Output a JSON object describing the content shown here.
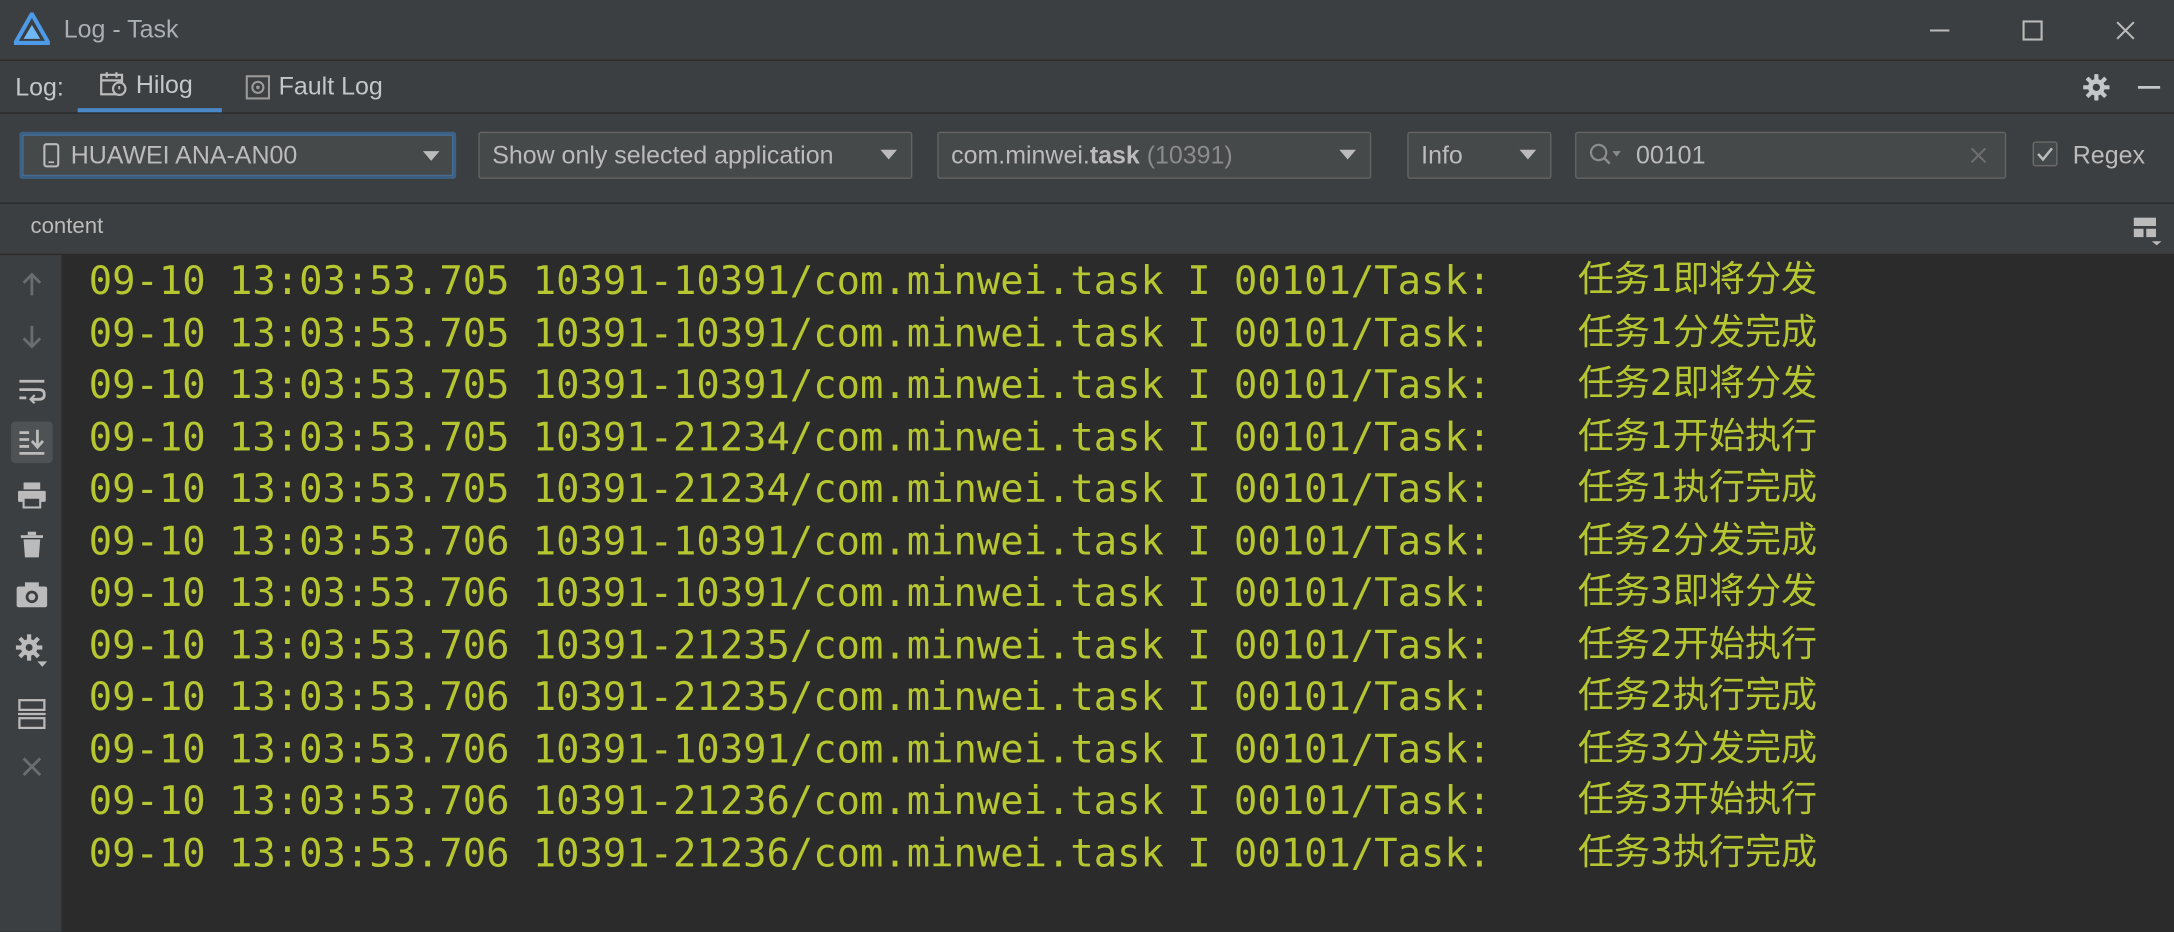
{
  "window": {
    "title": "Log - Task"
  },
  "tabs": {
    "label": "Log:",
    "items": [
      {
        "label": "Hilog"
      },
      {
        "label": "Fault Log"
      }
    ]
  },
  "filters": {
    "device": "HUAWEI ANA-AN00",
    "app_filter": "Show only selected application",
    "process_prefix": "com.minwei.",
    "process_bold": "task",
    "process_pid": "(10391)",
    "level": "Info",
    "search_value": "00101",
    "regex_label": "Regex",
    "regex_checked": true
  },
  "content_header": "content",
  "log": {
    "color": "#b6c631",
    "lines": [
      {
        "prefix": "09-10 13:03:53.705 10391-10391/com.minwei.task I 00101/Task:",
        "message": "任务1即将分发"
      },
      {
        "prefix": "09-10 13:03:53.705 10391-10391/com.minwei.task I 00101/Task:",
        "message": "任务1分发完成"
      },
      {
        "prefix": "09-10 13:03:53.705 10391-10391/com.minwei.task I 00101/Task:",
        "message": "任务2即将分发"
      },
      {
        "prefix": "09-10 13:03:53.705 10391-21234/com.minwei.task I 00101/Task:",
        "message": "任务1开始执行"
      },
      {
        "prefix": "09-10 13:03:53.705 10391-21234/com.minwei.task I 00101/Task:",
        "message": "任务1执行完成"
      },
      {
        "prefix": "09-10 13:03:53.706 10391-10391/com.minwei.task I 00101/Task:",
        "message": "任务2分发完成"
      },
      {
        "prefix": "09-10 13:03:53.706 10391-10391/com.minwei.task I 00101/Task:",
        "message": "任务3即将分发"
      },
      {
        "prefix": "09-10 13:03:53.706 10391-21235/com.minwei.task I 00101/Task:",
        "message": "任务2开始执行"
      },
      {
        "prefix": "09-10 13:03:53.706 10391-21235/com.minwei.task I 00101/Task:",
        "message": "任务2执行完成"
      },
      {
        "prefix": "09-10 13:03:53.706 10391-10391/com.minwei.task I 00101/Task:",
        "message": "任务3分发完成"
      },
      {
        "prefix": "09-10 13:03:53.706 10391-21236/com.minwei.task I 00101/Task:",
        "message": "任务3开始执行"
      },
      {
        "prefix": "09-10 13:03:53.706 10391-21236/com.minwei.task I 00101/Task:",
        "message": "任务3执行完成"
      }
    ]
  },
  "icons": {
    "app_logo": "deveco-logo-icon",
    "window_buttons": [
      "minimize-icon",
      "maximize-icon",
      "close-icon"
    ],
    "tab_icons": [
      "hilog-icon",
      "fault-log-icon"
    ],
    "toolbar_right": [
      "gear-icon",
      "hide-panel-icon"
    ],
    "sidebar": [
      "scroll-up-icon",
      "scroll-down-icon",
      "soft-wrap-icon",
      "scroll-to-end-icon",
      "print-icon",
      "delete-icon",
      "screenshot-icon",
      "settings-icon",
      "layout-icon",
      "close-icon"
    ]
  }
}
